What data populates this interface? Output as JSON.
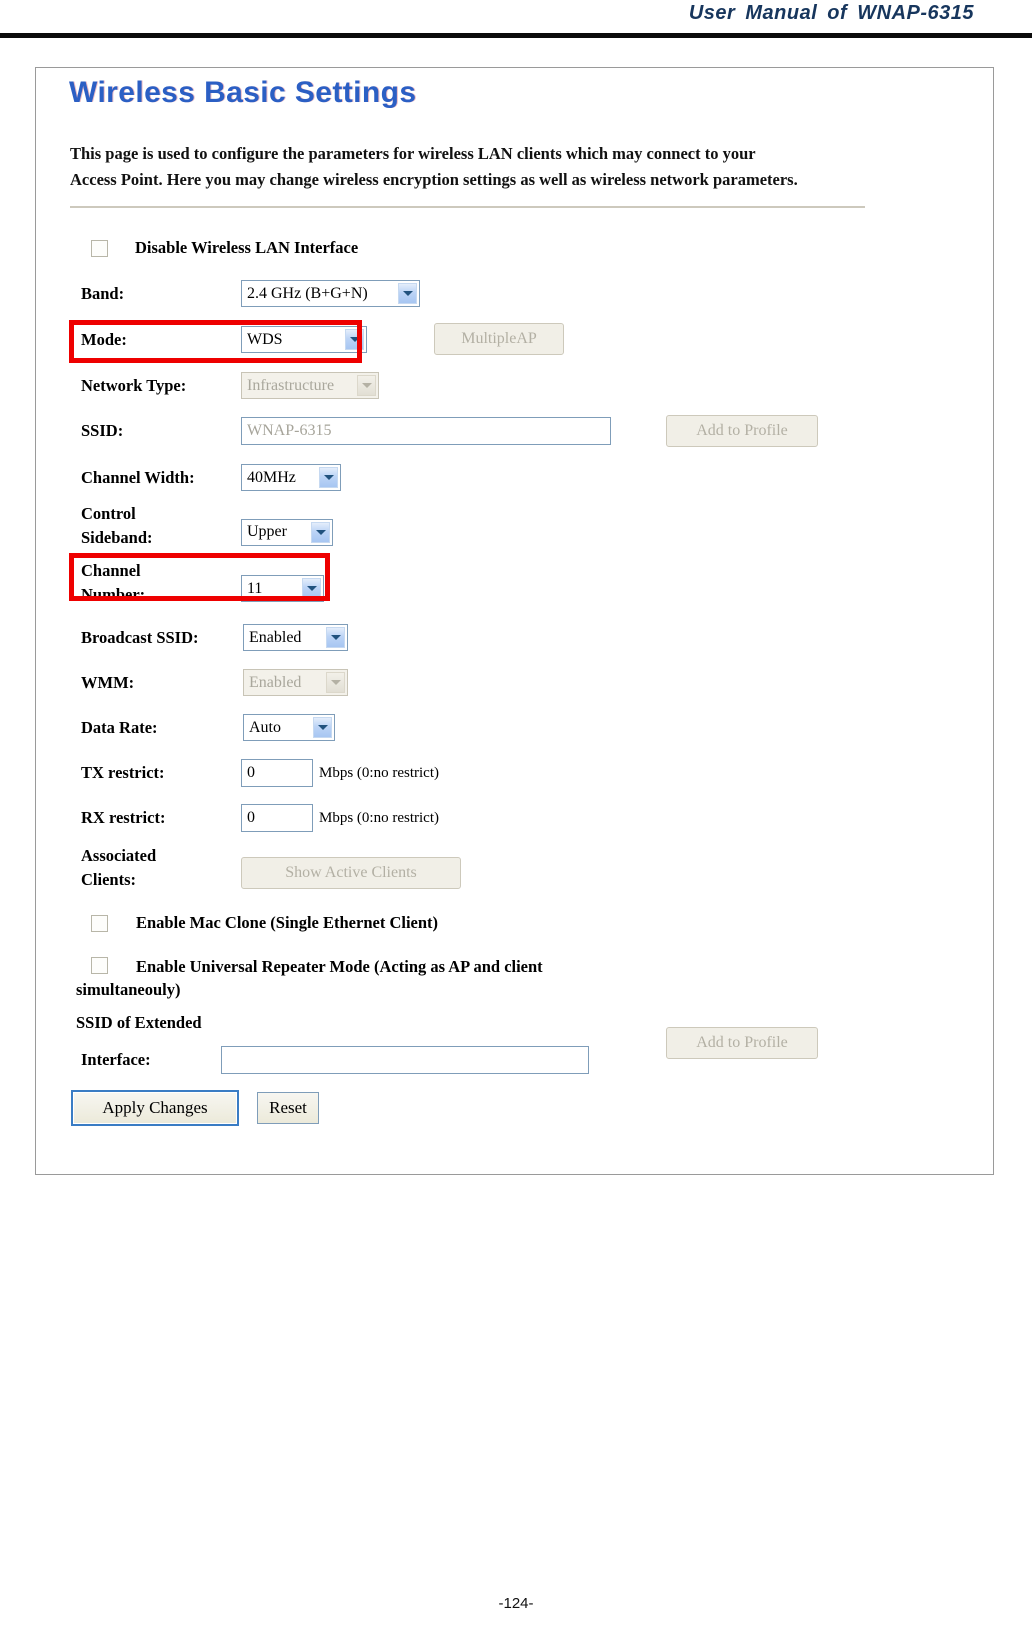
{
  "manual": {
    "header_title": "User  Manual  of  WNAP-6315",
    "page_footer": "-124-"
  },
  "page": {
    "title": "Wireless Basic Settings",
    "description_line1": "This page is used to configure the parameters for wireless LAN clients which may connect to your",
    "description_line2": "Access Point. Here you may change wireless encryption settings as well as wireless network parameters."
  },
  "form": {
    "disable_wlan_label": "Disable Wireless LAN Interface",
    "disable_wlan_checked": false,
    "band_label": "Band:",
    "band_value": "2.4 GHz (B+G+N)",
    "mode_label": "Mode:",
    "mode_value": "WDS",
    "multiple_ap_button": "MultipleAP",
    "network_type_label": "Network Type:",
    "network_type_value": "Infrastructure",
    "ssid_label": "SSID:",
    "ssid_value": "WNAP-6315",
    "ssid_add_to_profile_button": "Add to Profile",
    "channel_width_label": "Channel Width:",
    "channel_width_value": "40MHz",
    "control_sideband_label_line1": "Control",
    "control_sideband_label_line2": "Sideband:",
    "control_sideband_value": "Upper",
    "channel_number_label_line1": "Channel",
    "channel_number_label_line2": "Number:",
    "channel_number_value": "11",
    "broadcast_ssid_label": "Broadcast SSID:",
    "broadcast_ssid_value": "Enabled",
    "wmm_label": "WMM:",
    "wmm_value": "Enabled",
    "data_rate_label": "Data Rate:",
    "data_rate_value": "Auto",
    "tx_restrict_label": "TX restrict:",
    "tx_restrict_value": "0",
    "tx_restrict_unit": "Mbps (0:no restrict)",
    "rx_restrict_label": "RX restrict:",
    "rx_restrict_value": "0",
    "rx_restrict_unit": "Mbps (0:no restrict)",
    "associated_clients_label_line1": "Associated",
    "associated_clients_label_line2": "Clients:",
    "show_active_clients_button": "Show Active Clients",
    "mac_clone_label": "Enable Mac Clone (Single Ethernet Client)",
    "mac_clone_checked": false,
    "universal_repeater_label_line1": "Enable Universal Repeater Mode (Acting as AP and client",
    "universal_repeater_label_line2": "simultaneouly)",
    "universal_repeater_checked": false,
    "extended_ssid_label_line1": "SSID of Extended",
    "extended_ssid_label_line2": "Interface:",
    "extended_ssid_value": "",
    "extended_add_to_profile_button": "Add to Profile",
    "apply_changes_button": "Apply Changes",
    "reset_button": "Reset"
  },
  "colors": {
    "title_blue": "#2b5fc4",
    "header_navy": "#17365d",
    "highlight_red": "#ee0000",
    "select_border": "#7f9db9"
  }
}
